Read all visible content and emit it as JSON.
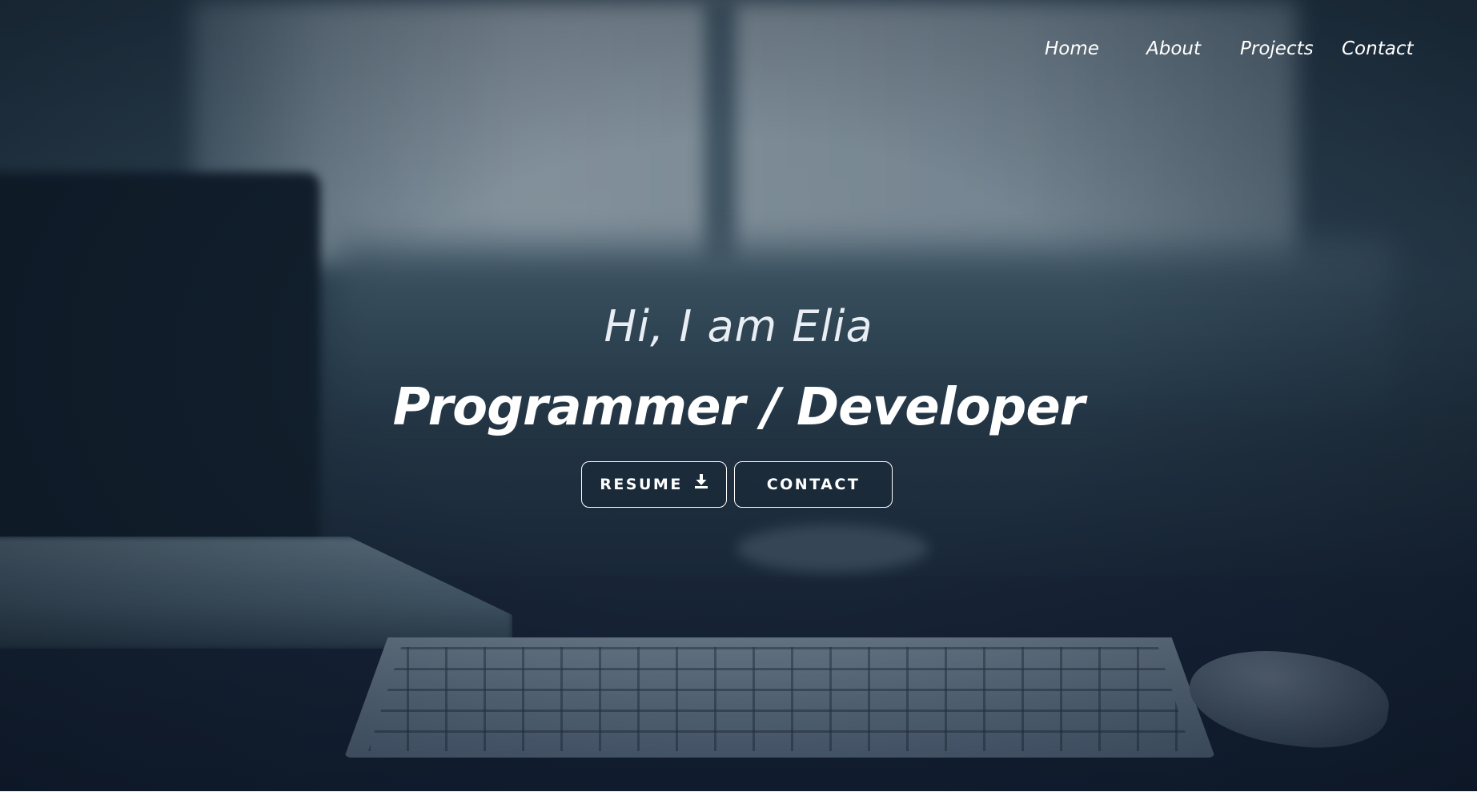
{
  "nav": {
    "items": [
      {
        "label": "Home"
      },
      {
        "label": "About"
      },
      {
        "label": "Projects"
      },
      {
        "label": "Contact"
      }
    ]
  },
  "hero": {
    "greeting": "Hi, I am Elia",
    "headline": "Programmer / Developer",
    "buttons": {
      "resume_label": "RESUME",
      "resume_icon": "download-icon",
      "contact_label": "CONTACT"
    }
  },
  "colors": {
    "text": "#ffffff",
    "overlay": "#0e1a28",
    "button_border": "#ffffff"
  }
}
